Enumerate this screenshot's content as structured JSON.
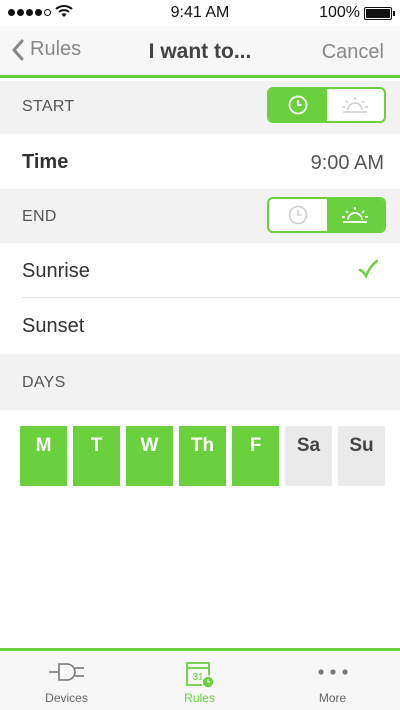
{
  "status_bar": {
    "time": "9:41 AM",
    "battery": "100%"
  },
  "nav": {
    "back_label": "Rules",
    "title": "I want to...",
    "cancel_label": "Cancel"
  },
  "start": {
    "header": "START",
    "mode": "time",
    "row_label": "Time",
    "row_value": "9:00 AM"
  },
  "end": {
    "header": "END",
    "mode": "sun",
    "options": [
      {
        "label": "Sunrise",
        "selected": true
      },
      {
        "label": "Sunset",
        "selected": false
      }
    ]
  },
  "days": {
    "header": "DAYS",
    "items": [
      {
        "label": "M",
        "active": true
      },
      {
        "label": "T",
        "active": true
      },
      {
        "label": "W",
        "active": true
      },
      {
        "label": "Th",
        "active": true
      },
      {
        "label": "F",
        "active": true
      },
      {
        "label": "Sa",
        "active": false
      },
      {
        "label": "Su",
        "active": false
      }
    ]
  },
  "tabs": [
    {
      "label": "Devices",
      "icon": "plug-icon",
      "active": false
    },
    {
      "label": "Rules",
      "icon": "calendar-icon",
      "active": true,
      "icon_text": "31"
    },
    {
      "label": "More",
      "icon": "more-icon",
      "active": false
    }
  ],
  "colors": {
    "accent": "#6ad03d",
    "header_bg": "#f2f2f2",
    "day_off": "#eaeaea"
  }
}
